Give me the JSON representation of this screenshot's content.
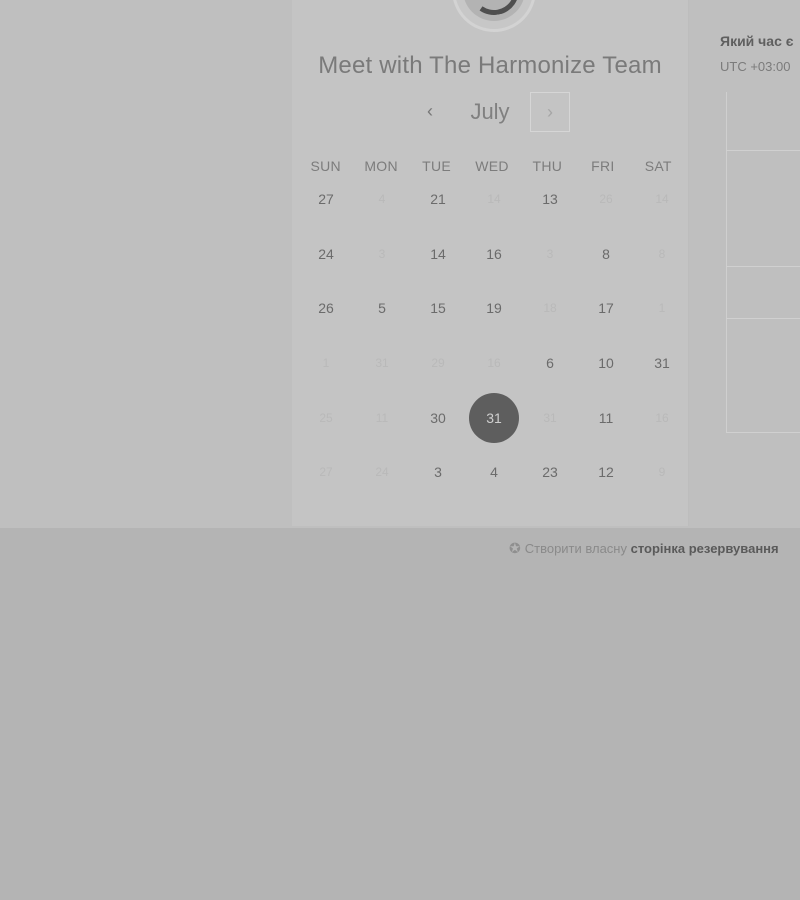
{
  "header": {
    "title": "Meet with The Harmonize Team"
  },
  "calendar": {
    "month": "July",
    "prev_icon": "chevron-left-icon",
    "next_icon": "chevron-right-icon",
    "weekdays": [
      "SUN",
      "MON",
      "TUE",
      "WED",
      "THU",
      "FRI",
      "SAT"
    ],
    "weeks": [
      [
        {
          "d": "27",
          "m": false
        },
        {
          "d": "4",
          "m": true
        },
        {
          "d": "21",
          "m": false
        },
        {
          "d": "14",
          "m": true
        },
        {
          "d": "13",
          "m": false
        },
        {
          "d": "26",
          "m": true
        },
        {
          "d": "14",
          "m": true
        }
      ],
      [
        {
          "d": "24",
          "m": false
        },
        {
          "d": "3",
          "m": true
        },
        {
          "d": "14",
          "m": false
        },
        {
          "d": "16",
          "m": false
        },
        {
          "d": "3",
          "m": true
        },
        {
          "d": "8",
          "m": false
        },
        {
          "d": "8",
          "m": true
        }
      ],
      [
        {
          "d": "26",
          "m": false
        },
        {
          "d": "5",
          "m": false
        },
        {
          "d": "15",
          "m": false
        },
        {
          "d": "19",
          "m": false
        },
        {
          "d": "18",
          "m": true
        },
        {
          "d": "17",
          "m": false
        },
        {
          "d": "1",
          "m": true
        }
      ],
      [
        {
          "d": "1",
          "m": true
        },
        {
          "d": "31",
          "m": true
        },
        {
          "d": "29",
          "m": true
        },
        {
          "d": "16",
          "m": true
        },
        {
          "d": "6",
          "m": false
        },
        {
          "d": "10",
          "m": false
        },
        {
          "d": "31",
          "m": false
        }
      ],
      [
        {
          "d": "25",
          "m": true
        },
        {
          "d": "11",
          "m": true
        },
        {
          "d": "30",
          "m": false
        },
        {
          "d": "31",
          "m": false,
          "selected": true
        },
        {
          "d": "31",
          "m": true
        },
        {
          "d": "11",
          "m": false
        },
        {
          "d": "16",
          "m": true
        }
      ],
      [
        {
          "d": "27",
          "m": true
        },
        {
          "d": "24",
          "m": true
        },
        {
          "d": "3",
          "m": false
        },
        {
          "d": "4",
          "m": false
        },
        {
          "d": "23",
          "m": false
        },
        {
          "d": "12",
          "m": false
        },
        {
          "d": "9",
          "m": true
        }
      ]
    ]
  },
  "timezone": {
    "question": "Який час є",
    "value": "UTC +03:00"
  },
  "footer": {
    "icon": "hubspot-sprocket-icon",
    "text": "Створити власну",
    "link": "сторінка резервування"
  },
  "colors": {
    "background": "#b4b4b4",
    "card": "#c4c4c4",
    "selected_day": "#5e5e5e"
  }
}
